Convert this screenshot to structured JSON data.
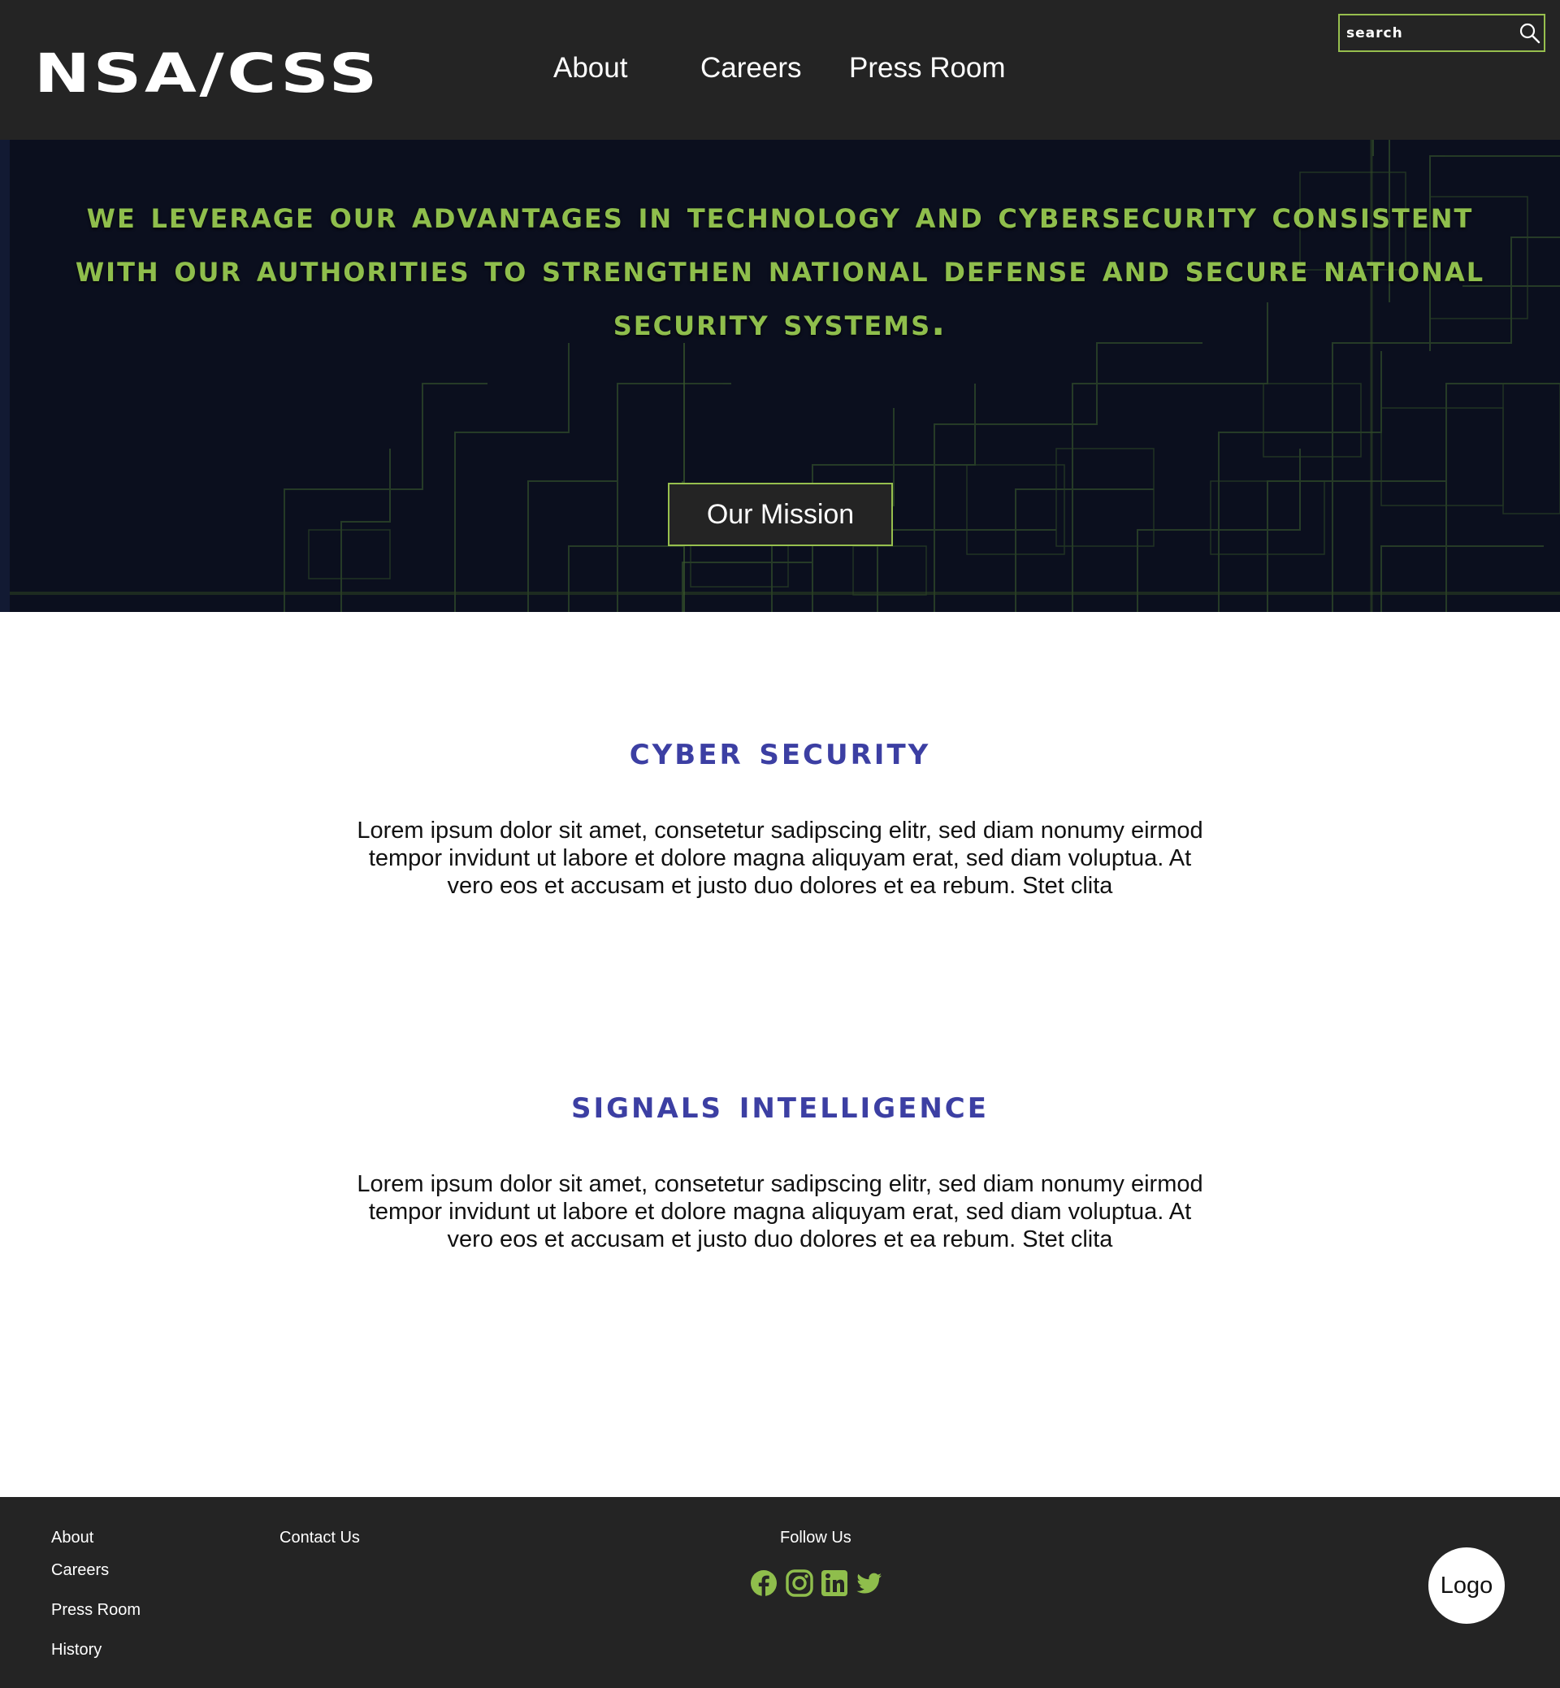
{
  "header": {
    "logo": "NSA/CSS",
    "nav": [
      {
        "label": "About"
      },
      {
        "label": "Careers"
      },
      {
        "label": "Press Room"
      }
    ],
    "search": {
      "placeholder": "search",
      "icon": "search-icon"
    }
  },
  "hero": {
    "text": "We leverage our advantages in technology and cybersecurity consistent with our authorities to strengthen national defense and secure national security systems.",
    "button_label": "Our Mission"
  },
  "sections": [
    {
      "title": "Cyber Security",
      "body": "Lorem ipsum dolor sit amet, consetetur sadipscing elitr, sed diam nonumy eirmod tempor invidunt ut labore et dolore magna aliquyam erat, sed diam voluptua. At vero eos et accusam et justo duo dolores et ea rebum. Stet clita"
    },
    {
      "title": "Signals Intelligence",
      "body": "Lorem ipsum dolor sit amet, consetetur sadipscing elitr, sed diam nonumy eirmod tempor invidunt ut labore et dolore magna aliquyam erat, sed diam voluptua. At vero eos et accusam et justo duo dolores et ea rebum. Stet clita"
    }
  ],
  "footer": {
    "links": [
      "About",
      "Careers",
      "Press Room",
      "History"
    ],
    "contact": "Contact Us",
    "follow": "Follow Us",
    "social_icons": [
      "facebook-icon",
      "instagram-icon",
      "linkedin-icon",
      "twitter-icon"
    ],
    "logo": "Logo"
  },
  "colors": {
    "header_bg": "#242424",
    "accent_green": "#97bf4e",
    "hero_text": "#8fbe4c",
    "hero_bg": "#0b0f1e",
    "section_title": "#3c3fa3",
    "footer_bg": "#242424"
  }
}
